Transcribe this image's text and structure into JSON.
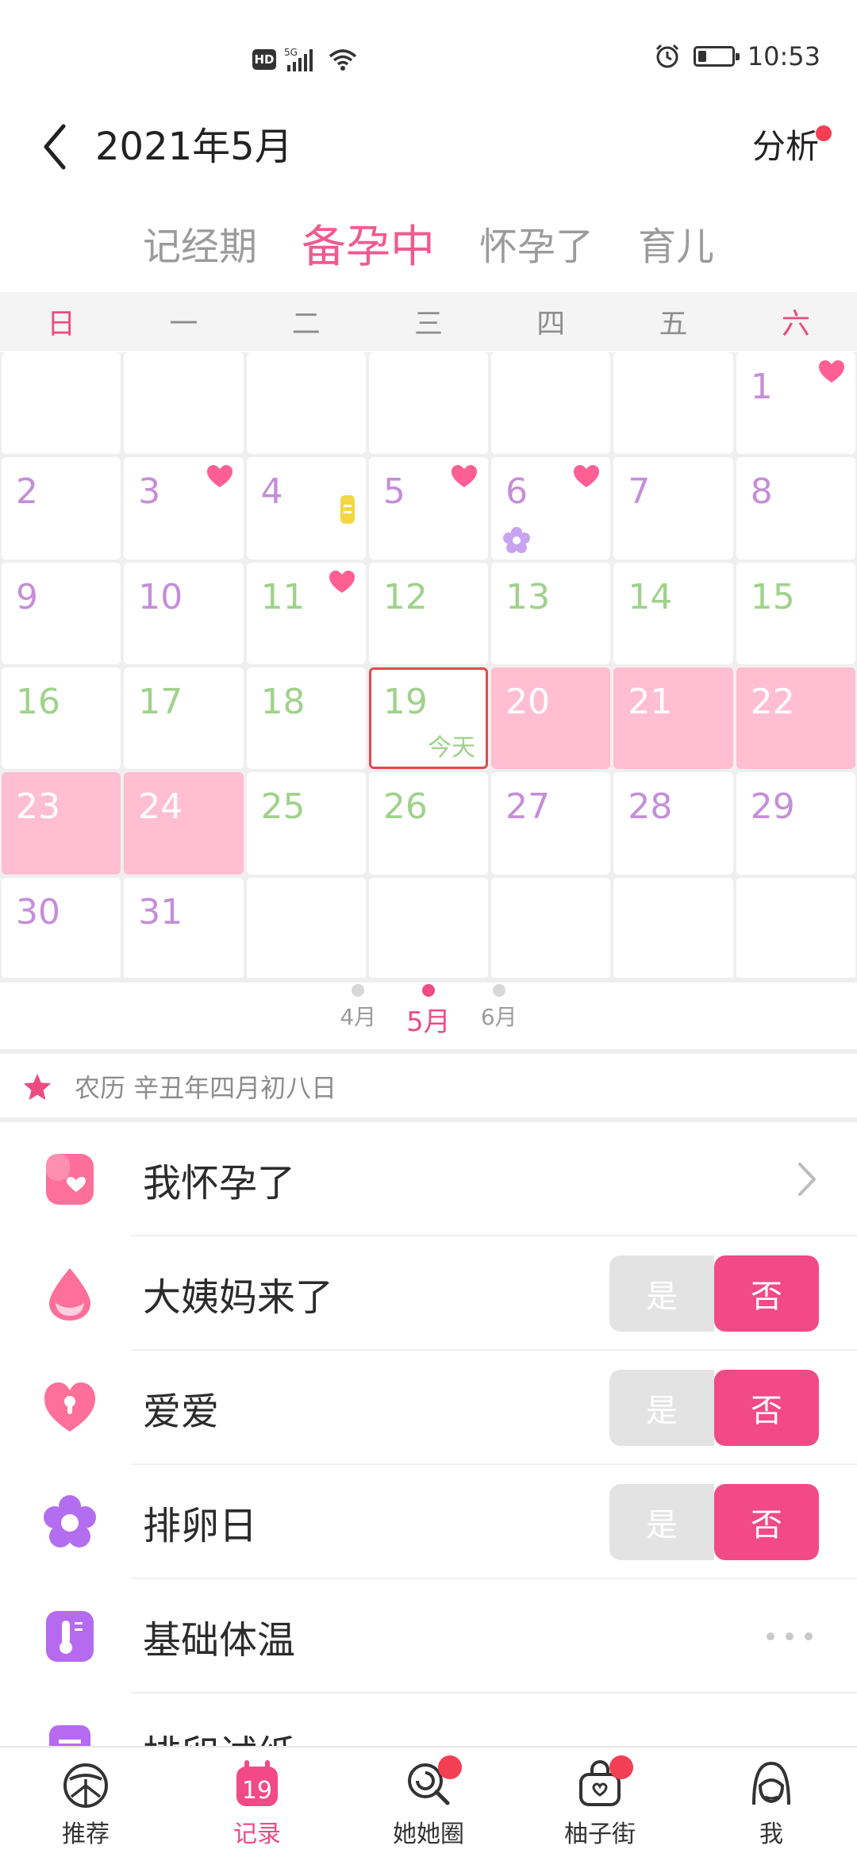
{
  "status": {
    "hd": "HD",
    "network": "5G",
    "time": "10:53",
    "battery_percent": 25
  },
  "header": {
    "title": "2021年5月",
    "analysis": "分析"
  },
  "modes": [
    "记经期",
    "备孕中",
    "怀孕了",
    "育儿"
  ],
  "active_mode": 1,
  "weekdays": [
    "日",
    "一",
    "二",
    "三",
    "四",
    "五",
    "六"
  ],
  "calendar": [
    [
      {
        "d": ""
      },
      {
        "d": ""
      },
      {
        "d": ""
      },
      {
        "d": ""
      },
      {
        "d": ""
      },
      {
        "d": ""
      },
      {
        "d": "1",
        "c": "purple",
        "heart": true
      }
    ],
    [
      {
        "d": "2",
        "c": "purple"
      },
      {
        "d": "3",
        "c": "purple",
        "heart": true
      },
      {
        "d": "4",
        "c": "purple",
        "tag": true
      },
      {
        "d": "5",
        "c": "purple",
        "heart": true
      },
      {
        "d": "6",
        "c": "purple",
        "heart": true,
        "flower": true
      },
      {
        "d": "7",
        "c": "purple"
      },
      {
        "d": "8",
        "c": "purple"
      }
    ],
    [
      {
        "d": "9",
        "c": "purple"
      },
      {
        "d": "10",
        "c": "purple"
      },
      {
        "d": "11",
        "c": "green",
        "heart": true
      },
      {
        "d": "12",
        "c": "green"
      },
      {
        "d": "13",
        "c": "green"
      },
      {
        "d": "14",
        "c": "green"
      },
      {
        "d": "15",
        "c": "green"
      }
    ],
    [
      {
        "d": "16",
        "c": "green"
      },
      {
        "d": "17",
        "c": "green"
      },
      {
        "d": "18",
        "c": "green"
      },
      {
        "d": "19",
        "c": "green",
        "today": true
      },
      {
        "d": "20",
        "c": "white",
        "pink": true
      },
      {
        "d": "21",
        "c": "white",
        "pink": true
      },
      {
        "d": "22",
        "c": "white",
        "pink": true
      }
    ],
    [
      {
        "d": "23",
        "c": "white",
        "pink": true
      },
      {
        "d": "24",
        "c": "white",
        "pink": true
      },
      {
        "d": "25",
        "c": "green"
      },
      {
        "d": "26",
        "c": "green"
      },
      {
        "d": "27",
        "c": "purple"
      },
      {
        "d": "28",
        "c": "purple"
      },
      {
        "d": "29",
        "c": "purple"
      }
    ],
    [
      {
        "d": "30",
        "c": "purple"
      },
      {
        "d": "31",
        "c": "purple"
      },
      {
        "d": ""
      },
      {
        "d": ""
      },
      {
        "d": ""
      },
      {
        "d": ""
      },
      {
        "d": ""
      }
    ]
  ],
  "today_label": "今天",
  "months": [
    "4月",
    "5月",
    "6月"
  ],
  "active_month": 1,
  "lunar": "农历 辛丑年四月初八日",
  "list": [
    {
      "label": "我怀孕了",
      "type": "chevron",
      "icon": "pregnant-icon"
    },
    {
      "label": "大姨妈来了",
      "type": "toggle",
      "icon": "drop-icon",
      "yes": "是",
      "no": "否"
    },
    {
      "label": "爱爱",
      "type": "toggle",
      "icon": "heart-keyhole-icon",
      "yes": "是",
      "no": "否"
    },
    {
      "label": "排卵日",
      "type": "toggle",
      "icon": "flower-icon",
      "yes": "是",
      "no": "否"
    },
    {
      "label": "基础体温",
      "type": "more",
      "icon": "thermometer-icon"
    },
    {
      "label": "排卵试纸",
      "type": "more",
      "icon": "test-strip-icon"
    }
  ],
  "nav": [
    {
      "label": "推荐",
      "icon": "citrus-icon",
      "badge": false
    },
    {
      "label": "记录",
      "icon": "calendar-icon",
      "badge": false,
      "calendar_day": "19"
    },
    {
      "label": "她她圈",
      "icon": "lollipop-icon",
      "badge": true
    },
    {
      "label": "柚子街",
      "icon": "shopping-bag-icon",
      "badge": true
    },
    {
      "label": "我",
      "icon": "girl-avatar-icon",
      "badge": false
    }
  ],
  "active_nav": 1,
  "colors": {
    "accent": "#ee4b83",
    "pink_cell": "#ffbed1",
    "purple_text": "#c58ed9",
    "green_text": "#9fd28b",
    "toggle_no": "#f24a86"
  }
}
